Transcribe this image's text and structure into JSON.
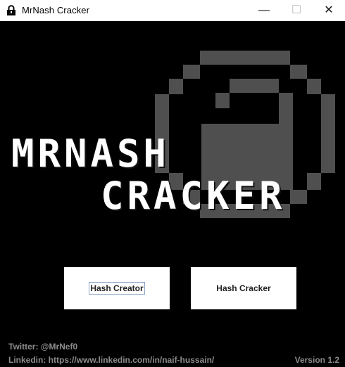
{
  "window": {
    "title": "MrNash Cracker",
    "icon": "lock-icon",
    "controls": {
      "minimize_symbol": "—",
      "maximize_symbol": "☐",
      "close_symbol": "✕"
    }
  },
  "hero": {
    "line_1": "MRNASH",
    "line_2": "CRACKER",
    "background_icon": "pixel-lock-icon"
  },
  "actions": {
    "hash_creator_label": "Hash Creator",
    "hash_cracker_label": "Hash Cracker"
  },
  "footer": {
    "twitter": "Twitter: @MrNef0",
    "linkedin": "Linkedin: https://www.linkedin.com/in/naif-hussain/",
    "version": "Version 1.2"
  },
  "colors": {
    "background": "#000000",
    "titlebar": "#ffffff",
    "logo_text": "#ffffff",
    "lock_art": "#4f4f4f",
    "footer_text": "#8c8c8c",
    "button_bg": "#ffffff"
  }
}
